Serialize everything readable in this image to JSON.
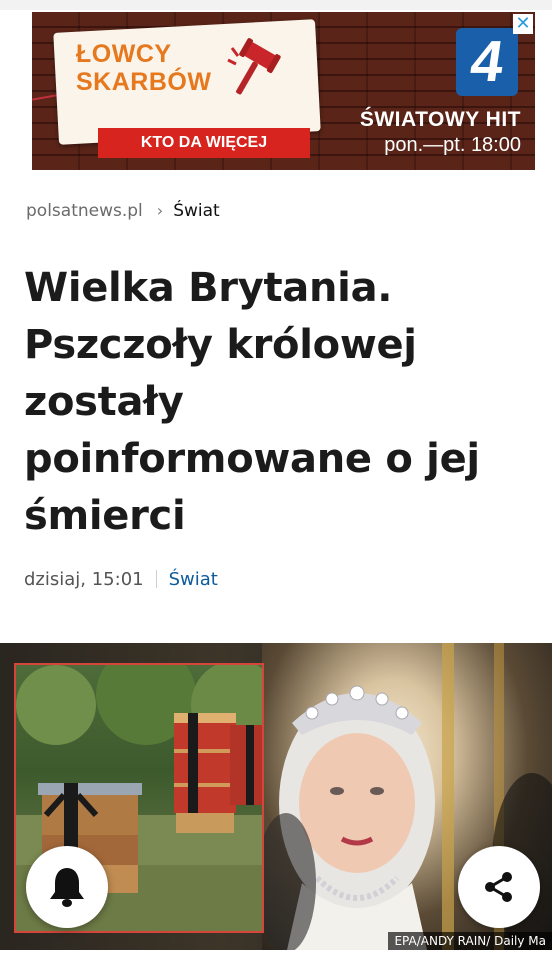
{
  "ad": {
    "brand_line1": "ŁOWCY",
    "brand_line2": "SKARBÓW",
    "tagline": "KTO DA WIĘCEJ",
    "channel_logo": "4",
    "promo": "ŚWIATOWY HIT",
    "schedule": "pon.—pt. 18:00",
    "close_icon": "✕"
  },
  "breadcrumb": {
    "site": "polsatnews.pl",
    "separator": "›",
    "category": "Świat"
  },
  "article": {
    "title": "Wielka Brytania. Pszczoły królowej zostały poinformowane o jej śmierci",
    "date": "dzisiaj, 15:01",
    "category": "Świat"
  },
  "photo": {
    "credit": "EPA/ANDY RAIN/ Daily Ma"
  },
  "icons": {
    "bell": "bell-icon",
    "share": "share-icon"
  },
  "colors": {
    "category_link": "#0d5b9a",
    "ad_red": "#d8241e",
    "ad_orange": "#e6781e",
    "channel_blue": "#1a5faa"
  }
}
